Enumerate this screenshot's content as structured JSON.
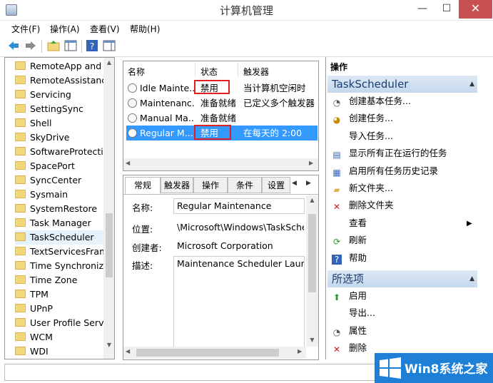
{
  "window": {
    "title": "计算机管理",
    "min": "—",
    "max": "☐",
    "close": "✕"
  },
  "menu": [
    "文件(F)",
    "操作(A)",
    "查看(V)",
    "帮助(H)"
  ],
  "tree": {
    "items": [
      "RemoteApp and D",
      "RemoteAssistance",
      "Servicing",
      "SettingSync",
      "Shell",
      "SkyDrive",
      "SoftwareProtectio",
      "SpacePort",
      "SyncCenter",
      "Sysmain",
      "SystemRestore",
      "Task Manager",
      "TaskScheduler",
      "TextServicesFrame",
      "Time Synchronizat",
      "Time Zone",
      "TPM",
      "UPnP",
      "User Profile Servic",
      "WCM",
      "WDI"
    ],
    "selected_index": 12
  },
  "tasks": {
    "columns": [
      "名称",
      "状态",
      "触发器"
    ],
    "rows": [
      {
        "name": "Idle Mainte...",
        "status": "禁用",
        "trigger": "当计算机空闲时"
      },
      {
        "name": "Maintenanc...",
        "status": "准备就绪",
        "trigger": "已定义多个触发器"
      },
      {
        "name": "Manual Ma...",
        "status": "准备就绪",
        "trigger": ""
      },
      {
        "name": "Regular M...",
        "status": "禁用",
        "trigger": "在每天的 2:00"
      }
    ],
    "selected_index": 3
  },
  "details": {
    "tabs": [
      "常规",
      "触发器",
      "操作",
      "条件",
      "设置"
    ],
    "active_tab": 0,
    "fields": [
      {
        "label": "名称:",
        "value": "Regular Maintenance",
        "boxed": true
      },
      {
        "label": "位置:",
        "value": "\\Microsoft\\Windows\\TaskSched",
        "boxed": false
      },
      {
        "label": "创建者:",
        "value": "Microsoft Corporation",
        "boxed": false
      },
      {
        "label": "描述:",
        "value": "Maintenance Scheduler Launch",
        "boxed": true
      }
    ]
  },
  "actions": {
    "header": "操作",
    "group1": "TaskScheduler",
    "group1_items": [
      {
        "icon": "create-basic-task-icon",
        "label": "创建基本任务..."
      },
      {
        "icon": "create-task-icon",
        "label": "创建任务..."
      },
      {
        "icon": "",
        "label": "导入任务..."
      },
      {
        "icon": "running-tasks-icon",
        "label": "显示所有正在运行的任务"
      },
      {
        "icon": "history-icon",
        "label": "启用所有任务历史记录"
      },
      {
        "icon": "new-folder-icon",
        "label": "新文件夹..."
      },
      {
        "icon": "delete-folder-icon",
        "label": "删除文件夹"
      },
      {
        "icon": "",
        "label": "查看"
      },
      {
        "icon": "refresh-icon",
        "label": "刷新"
      },
      {
        "icon": "help-icon",
        "label": "帮助"
      }
    ],
    "group2": "所选项",
    "group2_items": [
      {
        "icon": "run-icon",
        "label": "启用"
      },
      {
        "icon": "",
        "label": "导出..."
      },
      {
        "icon": "properties-icon",
        "label": "属性"
      },
      {
        "icon": "delete-icon",
        "label": "删除"
      }
    ]
  },
  "watermark": {
    "text": "Win8系统之家"
  },
  "colors": {
    "selection": "#3399ff",
    "highlight_box": "#e02020",
    "action_group": "#c5d8ee"
  }
}
